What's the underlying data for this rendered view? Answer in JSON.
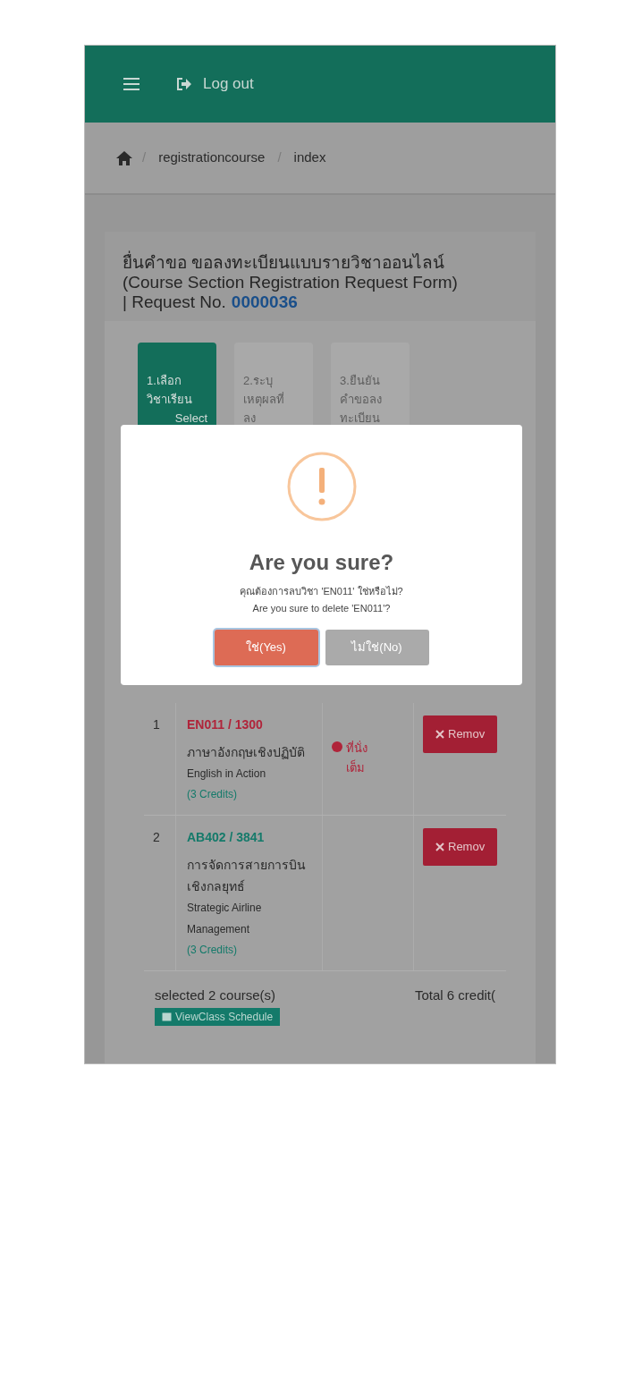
{
  "header": {
    "logout": "Log out"
  },
  "breadcrumb": [
    {
      "separator": "/",
      "label": "registrationcourse"
    },
    {
      "separator": "/",
      "label": "index"
    }
  ],
  "form": {
    "title_th": "ยื่นคำขอ ขอลงทะเบียนแบบรายวิชาออนไลน์",
    "title_en": "(Course Section Registration Request Form)",
    "request_label": "| Request No.",
    "request_no": "0000036"
  },
  "steps": [
    {
      "lines": [
        "1.เลือก",
        "วิชาเรียน",
        "Select"
      ],
      "selected": true
    },
    {
      "lines": [
        "2.ระบุ",
        "เหตุผลที่",
        "ลง"
      ],
      "selected": false
    },
    {
      "lines": [
        "3.ยืนยัน",
        "คำขอลง",
        "ทะเบียน"
      ],
      "selected": false
    }
  ],
  "courses": [
    {
      "no": "1",
      "code": "EN011 / 1300",
      "color": "#b0243a",
      "name_th": "ภาษาอังกฤษเชิงปฏิบัติ",
      "name_en": "English in Action",
      "credits": "(3 Credits)",
      "status": "ที่นั่งเต็ม",
      "action": "Remov"
    },
    {
      "no": "2",
      "code": "AB402 / 3841",
      "color": "#147a6a",
      "name_th": "การจัดการสายการบินเชิงกลยุทธ์",
      "name_en": "Strategic Airline Management",
      "credits": "(3 Credits)",
      "action": "Remov"
    }
  ],
  "footer": {
    "selected": "selected 2 course(s)",
    "total": "Total 6 credit(",
    "schedule_button": "ViewClass Schedule"
  },
  "dialog": {
    "title": "Are you sure?",
    "message_th": "คุณต้องการลบวิชา 'EN011' ใช่หรือไม่?",
    "message_en": "Are you sure to delete 'EN011'?",
    "buttons": [
      {
        "label": "ใช่(Yes)",
        "kind": "confirm",
        "focused": true
      },
      {
        "label": "ไม่ใช่(No)",
        "kind": "cancel",
        "focused": false
      }
    ]
  }
}
